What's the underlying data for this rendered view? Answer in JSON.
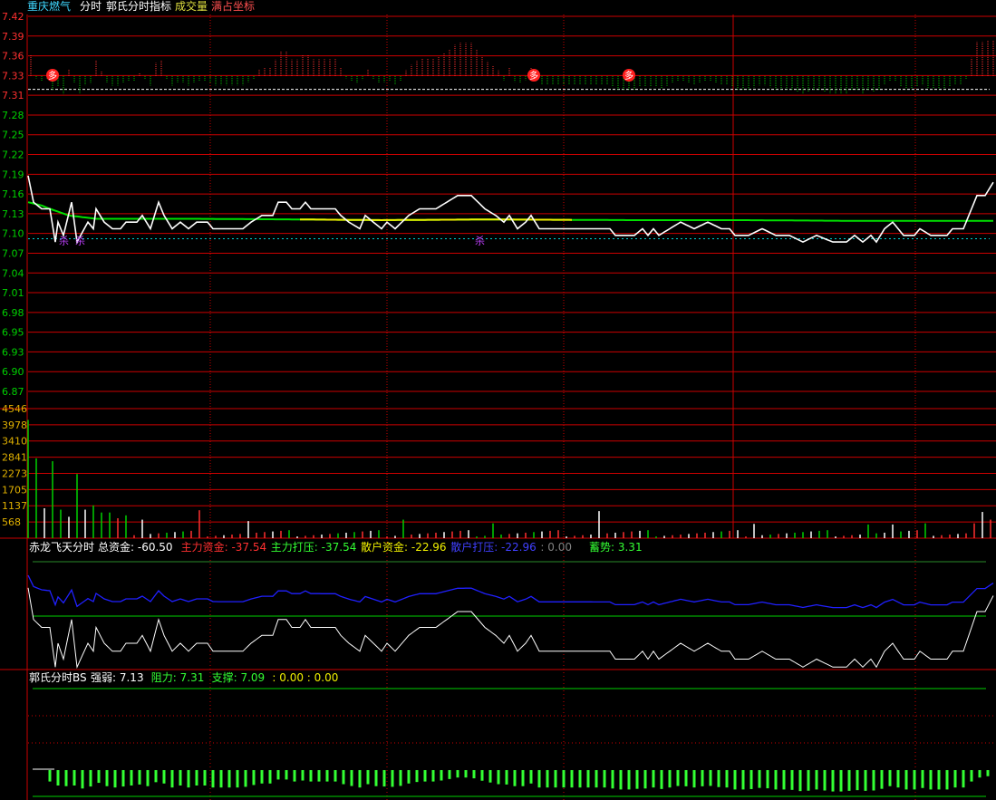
{
  "header": {
    "stock_name": "重庆燃气",
    "mode": "分时",
    "indicator": "郭氏分时指标",
    "volume_label": "成交量",
    "coord_label": "满占坐标"
  },
  "colors": {
    "grid": "#cc0000",
    "price_up_label": "#ff3030",
    "price_down_label": "#00d000",
    "volume_axis_label": "#e0b000",
    "price_line": "#ffffff",
    "avg_line_green": "#00e000",
    "avg_line_yellow": "#f0f000",
    "cyan_text": "#3fd7ff",
    "blue_line": "#2020ff",
    "green_bar": "#33ff33"
  },
  "chart_data": [
    {
      "type": "line",
      "panel": "intraday-price",
      "y_ticks": [
        "7.42",
        "7.39",
        "7.36",
        "7.33",
        "7.31",
        "7.28",
        "7.25",
        "7.22",
        "7.19",
        "7.16",
        "7.13",
        "7.10",
        "7.07",
        "7.04",
        "7.01",
        "6.98",
        "6.95",
        "6.93",
        "6.90",
        "6.87"
      ],
      "ylim": [
        6.855,
        7.42
      ],
      "reference_level": 7.31,
      "support_level": 7.085,
      "markers": [
        {
          "label": "多",
          "index": 9,
          "kind": "buy"
        },
        {
          "label": "多",
          "index": 186,
          "kind": "buy"
        },
        {
          "label": "多",
          "index": 221,
          "kind": "buy"
        },
        {
          "label": "杀",
          "index": 10,
          "kind": "sell"
        },
        {
          "label": "杀",
          "index": 16,
          "kind": "sell"
        },
        {
          "label": "杀",
          "index": 163,
          "kind": "sell"
        }
      ],
      "series": [
        {
          "role": "price",
          "keypoints": [
            [
              0,
              7.18
            ],
            [
              2,
              7.14
            ],
            [
              5,
              7.13
            ],
            [
              8,
              7.13
            ],
            [
              10,
              7.08
            ],
            [
              11,
              7.11
            ],
            [
              13,
              7.09
            ],
            [
              16,
              7.14
            ],
            [
              18,
              7.08
            ],
            [
              22,
              7.11
            ],
            [
              24,
              7.1
            ],
            [
              25,
              7.13
            ],
            [
              28,
              7.11
            ],
            [
              31,
              7.1
            ],
            [
              34,
              7.1
            ],
            [
              36,
              7.11
            ],
            [
              40,
              7.11
            ],
            [
              42,
              7.12
            ],
            [
              45,
              7.1
            ],
            [
              48,
              7.14
            ],
            [
              50,
              7.12
            ],
            [
              53,
              7.1
            ],
            [
              56,
              7.11
            ],
            [
              59,
              7.1
            ],
            [
              62,
              7.11
            ],
            [
              66,
              7.11
            ],
            [
              68,
              7.1
            ],
            [
              79,
              7.1
            ],
            [
              82,
              7.11
            ],
            [
              86,
              7.12
            ],
            [
              90,
              7.12
            ],
            [
              92,
              7.14
            ],
            [
              95,
              7.14
            ],
            [
              97,
              7.13
            ],
            [
              100,
              7.13
            ],
            [
              102,
              7.14
            ],
            [
              104,
              7.13
            ],
            [
              110,
              7.13
            ],
            [
              113,
              7.13
            ],
            [
              115,
              7.12
            ],
            [
              118,
              7.11
            ],
            [
              122,
              7.1
            ],
            [
              124,
              7.12
            ],
            [
              127,
              7.11
            ],
            [
              130,
              7.1
            ],
            [
              132,
              7.11
            ],
            [
              135,
              7.1
            ],
            [
              140,
              7.12
            ],
            [
              144,
              7.13
            ],
            [
              150,
              7.13
            ],
            [
              154,
              7.14
            ],
            [
              158,
              7.15
            ],
            [
              163,
              7.15
            ],
            [
              168,
              7.13
            ],
            [
              172,
              7.12
            ],
            [
              175,
              7.11
            ],
            [
              177,
              7.12
            ],
            [
              180,
              7.1
            ],
            [
              183,
              7.11
            ],
            [
              185,
              7.12
            ],
            [
              188,
              7.1
            ],
            [
              200,
              7.1
            ],
            [
              214,
              7.1
            ],
            [
              216,
              7.09
            ],
            [
              223,
              7.09
            ],
            [
              226,
              7.1
            ],
            [
              228,
              7.09
            ],
            [
              230,
              7.1
            ],
            [
              232,
              7.09
            ],
            [
              236,
              7.1
            ],
            [
              240,
              7.11
            ],
            [
              245,
              7.1
            ],
            [
              250,
              7.11
            ],
            [
              255,
              7.1
            ],
            [
              258,
              7.1
            ],
            [
              260,
              7.09
            ],
            [
              265,
              7.09
            ],
            [
              270,
              7.1
            ],
            [
              275,
              7.09
            ],
            [
              280,
              7.09
            ],
            [
              285,
              7.08
            ],
            [
              290,
              7.09
            ],
            [
              296,
              7.08
            ],
            [
              301,
              7.08
            ],
            [
              304,
              7.09
            ],
            [
              307,
              7.08
            ],
            [
              310,
              7.09
            ],
            [
              312,
              7.08
            ],
            [
              315,
              7.1
            ],
            [
              318,
              7.11
            ],
            [
              322,
              7.09
            ],
            [
              326,
              7.09
            ],
            [
              328,
              7.1
            ],
            [
              332,
              7.09
            ],
            [
              338,
              7.09
            ],
            [
              340,
              7.1
            ],
            [
              344,
              7.1
            ],
            [
              346,
              7.12
            ],
            [
              349,
              7.15
            ],
            [
              352,
              7.15
            ],
            [
              355,
              7.17
            ]
          ]
        },
        {
          "role": "average",
          "keypoints": [
            [
              0,
              7.14
            ],
            [
              5,
              7.135
            ],
            [
              8,
              7.13
            ],
            [
              15,
              7.12
            ],
            [
              25,
              7.115
            ],
            [
              60,
              7.115
            ],
            [
              100,
              7.114
            ],
            [
              130,
              7.113
            ],
            [
              170,
              7.114
            ],
            [
              220,
              7.113
            ],
            [
              260,
              7.113
            ],
            [
              300,
              7.112
            ],
            [
              355,
              7.112
            ]
          ]
        }
      ]
    },
    {
      "type": "bar",
      "panel": "volume",
      "y_ticks": [
        "4546",
        "3978",
        "3410",
        "2841",
        "2273",
        "1705",
        "1137",
        "568"
      ],
      "ylim": [
        0,
        4546
      ],
      "peaks": [
        {
          "index": 1,
          "value": 4150,
          "color": "green"
        },
        {
          "index": 3,
          "value": 2800,
          "color": "green"
        },
        {
          "index": 5,
          "value": 1230,
          "color": "white"
        },
        {
          "index": 7,
          "value": 1050,
          "color": "white"
        },
        {
          "index": 9,
          "value": 2700,
          "color": "green"
        },
        {
          "index": 11,
          "value": 1700,
          "color": "green"
        },
        {
          "index": 13,
          "value": 1000,
          "color": "green"
        },
        {
          "index": 16,
          "value": 750,
          "color": "white"
        },
        {
          "index": 19,
          "value": 2250,
          "color": "green"
        },
        {
          "index": 21,
          "value": 1000,
          "color": "white"
        },
        {
          "index": 25,
          "value": 1150,
          "color": "green"
        },
        {
          "index": 29,
          "value": 900,
          "color": "green"
        },
        {
          "index": 31,
          "value": 900,
          "color": "green"
        },
        {
          "index": 34,
          "value": 700,
          "color": "red"
        },
        {
          "index": 38,
          "value": 800,
          "color": "green"
        },
        {
          "index": 42,
          "value": 650,
          "color": "white"
        },
        {
          "index": 64,
          "value": 980,
          "color": "red"
        },
        {
          "index": 82,
          "value": 600,
          "color": "white"
        },
        {
          "index": 140,
          "value": 650,
          "color": "green"
        },
        {
          "index": 172,
          "value": 520,
          "color": "green"
        },
        {
          "index": 210,
          "value": 950,
          "color": "white"
        },
        {
          "index": 267,
          "value": 500,
          "color": "white"
        },
        {
          "index": 310,
          "value": 480,
          "color": "green"
        },
        {
          "index": 318,
          "value": 480,
          "color": "white"
        },
        {
          "index": 332,
          "value": 520,
          "color": "green"
        },
        {
          "index": 350,
          "value": 520,
          "color": "red"
        },
        {
          "index": 353,
          "value": 920,
          "color": "white"
        },
        {
          "index": 355,
          "value": 650,
          "color": "red"
        }
      ]
    },
    {
      "type": "line",
      "panel": "capital-flow",
      "title": "赤龙飞天分时",
      "labels": [
        {
          "text": "总资金: -60.50",
          "color": "#ffffff"
        },
        {
          "text": "主力资金: -37.54",
          "color": "#ff3030"
        },
        {
          "text": "主力打压: -37.54",
          "color": "#33ff33"
        },
        {
          "text": "散户资金: -22.96",
          "color": "#f0f000"
        },
        {
          "text": "散户打压: -22.96",
          "color": "#4040ff"
        },
        {
          "text": ": 0.00",
          "color": "#808080"
        },
        {
          "text": "蓄势: 3.31",
          "color": "#33ff33"
        }
      ]
    },
    {
      "type": "bar",
      "panel": "bs-strength",
      "title": "郭氏分时BS",
      "labels": [
        {
          "text": "强弱: 7.13",
          "color": "#ffffff"
        },
        {
          "text": "阻力: 7.31",
          "color": "#33ff33"
        },
        {
          "text": "支撑: 7.09",
          "color": "#33ff33"
        },
        {
          "text": ": 0.00 : 0.00",
          "color": "#f0f000"
        }
      ]
    }
  ]
}
